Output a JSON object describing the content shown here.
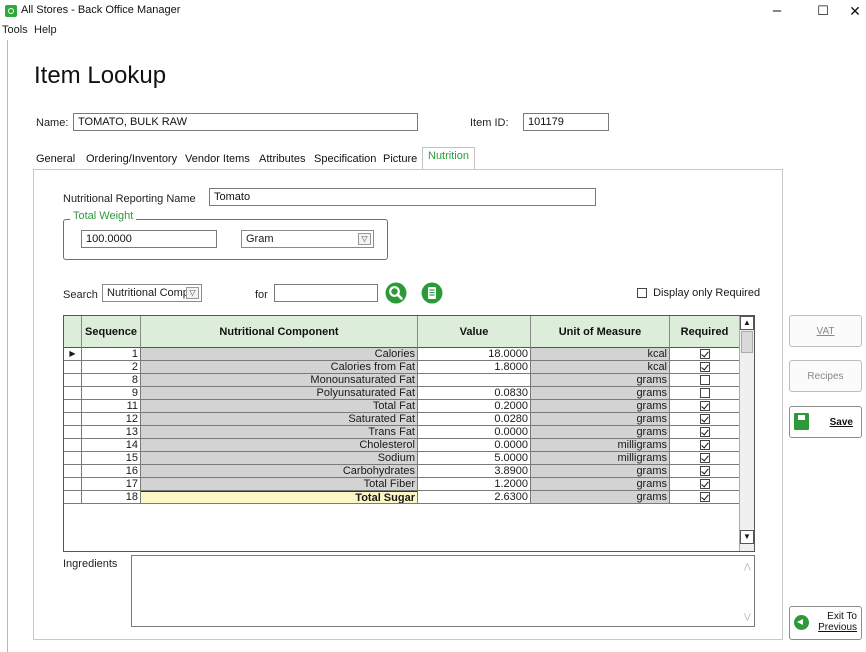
{
  "window": {
    "title": "All Stores - Back Office Manager",
    "minimize": "–",
    "maximize": "☐",
    "close": "✕"
  },
  "menu": [
    "Tools",
    "Help"
  ],
  "page_title": "Item Lookup",
  "item": {
    "name_label": "Name:",
    "name_value": "TOMATO, BULK RAW",
    "id_label": "Item ID:",
    "id_value": "101179"
  },
  "tabs": [
    {
      "label": "General",
      "active": false
    },
    {
      "label": "Ordering/Inventory",
      "active": false
    },
    {
      "label": "Vendor Items",
      "active": false
    },
    {
      "label": "Attributes",
      "active": false
    },
    {
      "label": "Specification",
      "active": false
    },
    {
      "label": "Picture",
      "active": false
    },
    {
      "label": "Nutrition",
      "active": true
    }
  ],
  "nutrition": {
    "reporting_name_label": "Nutritional Reporting Name",
    "reporting_name_value": "Tomato",
    "total_weight_title": "Total Weight",
    "total_weight_value": "100.0000",
    "unit_value": "Gram",
    "search_label": "Search",
    "search_field_value": "Nutritional Comp",
    "for_label": "for",
    "for_value": "",
    "display_only_required_label": "Display only Required",
    "display_only_required_checked": false,
    "ingredients_label": "Ingredients",
    "ingredients_value": ""
  },
  "grid": {
    "columns": [
      "Sequence",
      "Nutritional Component",
      "Value",
      "Unit of Measure",
      "Required"
    ],
    "rows": [
      {
        "seq": "1",
        "component": "Calories",
        "value": "18.0000",
        "uom": "kcal",
        "required": true,
        "current": true
      },
      {
        "seq": "2",
        "component": "Calories from Fat",
        "value": "1.8000",
        "uom": "kcal",
        "required": true
      },
      {
        "seq": "8",
        "component": "Monounsaturated Fat",
        "value": "",
        "uom": "grams",
        "required": false
      },
      {
        "seq": "9",
        "component": "Polyunsaturated Fat",
        "value": "0.0830",
        "uom": "grams",
        "required": false
      },
      {
        "seq": "11",
        "component": "Total Fat",
        "value": "0.2000",
        "uom": "grams",
        "required": true
      },
      {
        "seq": "12",
        "component": "Saturated Fat",
        "value": "0.0280",
        "uom": "grams",
        "required": true
      },
      {
        "seq": "13",
        "component": "Trans Fat",
        "value": "0.0000",
        "uom": "grams",
        "required": true
      },
      {
        "seq": "14",
        "component": "Cholesterol",
        "value": "0.0000",
        "uom": "milligrams",
        "required": true
      },
      {
        "seq": "15",
        "component": "Sodium",
        "value": "5.0000",
        "uom": "milligrams",
        "required": true
      },
      {
        "seq": "16",
        "component": "Carbohydrates",
        "value": "3.8900",
        "uom": "grams",
        "required": true
      },
      {
        "seq": "17",
        "component": "Total Fiber",
        "value": "1.2000",
        "uom": "grams",
        "required": true
      },
      {
        "seq": "18",
        "component": "Total Sugar",
        "value": "2.6300",
        "uom": "grams",
        "required": true,
        "editing": true
      }
    ],
    "current_row_marker": "▶",
    "scroll_up": "▲",
    "scroll_down": "▼"
  },
  "side_buttons": {
    "vat": "VAT",
    "recipes": "Recipes",
    "save": "Save",
    "exit_line1": "Exit To",
    "exit_line2": "Previous"
  },
  "icons": {
    "search": "search-icon",
    "list": "list-icon",
    "save": "floppy-icon",
    "exit": "back-arrow-icon"
  },
  "colors": {
    "accent_green": "#2d9a3a",
    "grid_header": "#dceed9",
    "readonly_cell": "#d3d3d3",
    "edit_cell": "#fdf7c5"
  }
}
